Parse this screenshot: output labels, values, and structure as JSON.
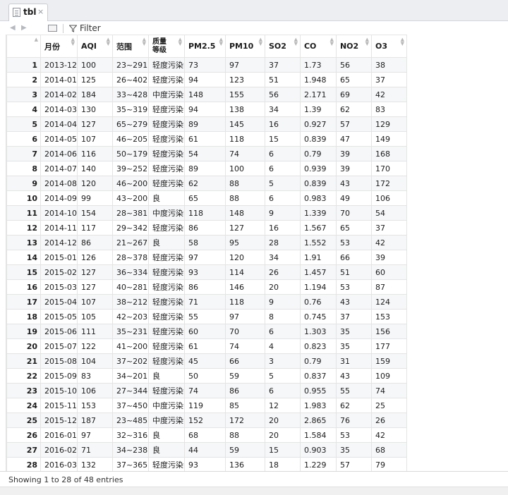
{
  "tab": {
    "label": "tbl",
    "close": "×"
  },
  "toolbar": {
    "filter_label": "Filter"
  },
  "table": {
    "columns": [
      "月份",
      "AQI",
      "范围",
      "质量\n等级",
      "PM2.5",
      "PM10",
      "SO2",
      "CO",
      "NO2",
      "O3"
    ],
    "rows": [
      [
        "1",
        "2013-12",
        "100",
        "23~291",
        "轻度污染",
        "73",
        "97",
        "37",
        "1.73",
        "56",
        "38"
      ],
      [
        "2",
        "2014-01",
        "125",
        "26~402",
        "轻度污染",
        "94",
        "123",
        "51",
        "1.948",
        "65",
        "37"
      ],
      [
        "3",
        "2014-02",
        "184",
        "33~428",
        "中度污染",
        "148",
        "155",
        "56",
        "2.171",
        "69",
        "42"
      ],
      [
        "4",
        "2014-03",
        "130",
        "35~319",
        "轻度污染",
        "94",
        "138",
        "34",
        "1.39",
        "62",
        "83"
      ],
      [
        "5",
        "2014-04",
        "127",
        "65~279",
        "轻度污染",
        "89",
        "145",
        "16",
        "0.927",
        "57",
        "129"
      ],
      [
        "6",
        "2014-05",
        "107",
        "46~205",
        "轻度污染",
        "61",
        "118",
        "15",
        "0.839",
        "47",
        "149"
      ],
      [
        "7",
        "2014-06",
        "116",
        "50~179",
        "轻度污染",
        "54",
        "74",
        "6",
        "0.79",
        "39",
        "168"
      ],
      [
        "8",
        "2014-07",
        "140",
        "39~252",
        "轻度污染",
        "89",
        "100",
        "6",
        "0.939",
        "39",
        "170"
      ],
      [
        "9",
        "2014-08",
        "120",
        "46~200",
        "轻度污染",
        "62",
        "88",
        "5",
        "0.839",
        "43",
        "172"
      ],
      [
        "10",
        "2014-09",
        "99",
        "43~200",
        "良",
        "65",
        "88",
        "6",
        "0.983",
        "49",
        "106"
      ],
      [
        "11",
        "2014-10",
        "154",
        "28~381",
        "中度污染",
        "118",
        "148",
        "9",
        "1.339",
        "70",
        "54"
      ],
      [
        "12",
        "2014-11",
        "117",
        "29~342",
        "轻度污染",
        "86",
        "127",
        "16",
        "1.567",
        "65",
        "37"
      ],
      [
        "13",
        "2014-12",
        "86",
        "21~267",
        "良",
        "58",
        "95",
        "28",
        "1.552",
        "53",
        "42"
      ],
      [
        "14",
        "2015-01",
        "126",
        "28~378",
        "轻度污染",
        "97",
        "120",
        "34",
        "1.91",
        "66",
        "39"
      ],
      [
        "15",
        "2015-02",
        "127",
        "36~334",
        "轻度污染",
        "93",
        "114",
        "26",
        "1.457",
        "51",
        "60"
      ],
      [
        "16",
        "2015-03",
        "127",
        "40~281",
        "轻度污染",
        "86",
        "146",
        "20",
        "1.194",
        "53",
        "87"
      ],
      [
        "17",
        "2015-04",
        "107",
        "38~212",
        "轻度污染",
        "71",
        "118",
        "9",
        "0.76",
        "43",
        "124"
      ],
      [
        "18",
        "2015-05",
        "105",
        "42~203",
        "轻度污染",
        "55",
        "97",
        "8",
        "0.745",
        "37",
        "153"
      ],
      [
        "19",
        "2015-06",
        "111",
        "35~231",
        "轻度污染",
        "60",
        "70",
        "6",
        "1.303",
        "35",
        "156"
      ],
      [
        "20",
        "2015-07",
        "122",
        "41~200",
        "轻度污染",
        "61",
        "74",
        "4",
        "0.823",
        "35",
        "177"
      ],
      [
        "21",
        "2015-08",
        "104",
        "37~202",
        "轻度污染",
        "45",
        "66",
        "3",
        "0.79",
        "31",
        "159"
      ],
      [
        "22",
        "2015-09",
        "83",
        "34~201",
        "良",
        "50",
        "59",
        "5",
        "0.837",
        "43",
        "109"
      ],
      [
        "23",
        "2015-10",
        "106",
        "27~344",
        "轻度污染",
        "74",
        "86",
        "6",
        "0.955",
        "55",
        "74"
      ],
      [
        "24",
        "2015-11",
        "153",
        "37~450",
        "中度污染",
        "119",
        "85",
        "12",
        "1.983",
        "62",
        "25"
      ],
      [
        "25",
        "2015-12",
        "187",
        "23~485",
        "中度污染",
        "152",
        "172",
        "20",
        "2.865",
        "76",
        "26"
      ],
      [
        "26",
        "2016-01",
        "97",
        "32~316",
        "良",
        "68",
        "88",
        "20",
        "1.584",
        "53",
        "42"
      ],
      [
        "27",
        "2016-02",
        "71",
        "34~238",
        "良",
        "44",
        "59",
        "15",
        "0.903",
        "35",
        "68"
      ],
      [
        "28",
        "2016-03",
        "132",
        "37~365",
        "轻度污染",
        "93",
        "136",
        "18",
        "1.229",
        "57",
        "79"
      ]
    ]
  },
  "status": {
    "text": "Showing 1 to 28 of 48 entries"
  }
}
